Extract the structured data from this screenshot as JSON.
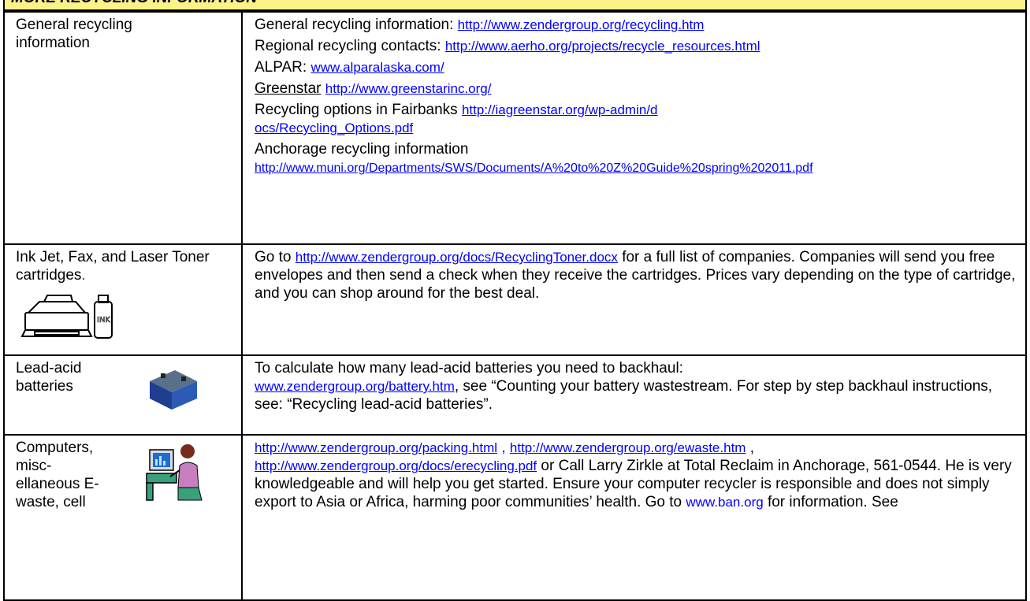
{
  "header": {
    "title": "MORE RECYCLING INFORMATION"
  },
  "rows": [
    {
      "label": "General recycling information",
      "entries": [
        {
          "text": "General recycling information: ",
          "link": "http://www.zendergroup.org/recycling.htm"
        },
        {
          "text": "Regional recycling contacts: ",
          "link": "http://www.aerho.org/projects/recycle_resources.html"
        },
        {
          "text": "ALPAR: ",
          "link": "www.alparalaska.com/"
        },
        {
          "text": "Greenstar",
          "link": "http://www.greenstarinc.org/"
        },
        {
          "text": "Recycling options in Fairbanks ",
          "link": "http://iagreenstar.org/wp-admin/docs/Recycling_Options.pdf"
        },
        {
          "text": "Anchorage recycling information",
          "link": "http://www.muni.org/Departments/SWS/Documents/A%20to%20Z%20Guide%20spring%202011.pdf"
        }
      ]
    },
    {
      "label_main": "Ink Jet, Fax, and Laser Toner cartridges",
      "label_dot": ".",
      "icon": "printer-and-ink-bottle-icon",
      "intro": "Go to ",
      "link": "http://www.zendergroup.org/docs/RecyclingToner.docx",
      "text": "  for a full list of companies.  Companies will send you free envelopes and then send a check when they receive the cartridges.  Prices vary depending on the type of cartridge, and you can shop around for the best deal."
    },
    {
      "label": "Lead-acid batteries",
      "icon": "car-battery-icon",
      "intro": "To calculate how many lead-acid batteries you need to backhaul: ",
      "link": "www.zendergroup.org/battery.htm",
      "text": ", see “Counting your battery wastestream.  For step by step backhaul instructions, see: “Recycling lead-acid batteries”."
    },
    {
      "label": "Computers, misc-ellaneous E-waste, cell",
      "icon": "person-at-computer-icon",
      "link1": "http://www.zendergroup.org/packing.html",
      "sep1": " ,  ",
      "link2": "http://www.zendergroup.org/ewaste.htm",
      "sep2": " , ",
      "link3": "http://www.zendergroup.org/docs/erecycling.pdf",
      "text1": " or Call Larry Zirkle at Total Reclaim in Anchorage, 561-0544.  He is very knowledgeable and will help you get started.  Ensure your computer recycler is responsible and does not simply export to Asia or Africa, harming poor communities’ health.  Go to ",
      "link4": "www.ban.org",
      "text2": " for information.  See"
    }
  ]
}
